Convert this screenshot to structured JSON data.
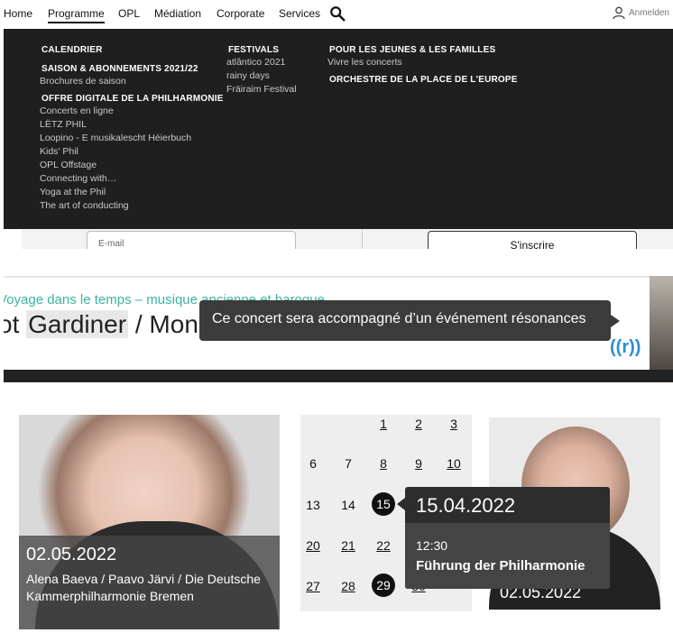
{
  "nav": {
    "items": [
      "Home",
      "Programme",
      "OPL",
      "Médiation",
      "Corporate",
      "Services"
    ],
    "active": "Programme",
    "login_label": "Anmelden"
  },
  "menu": {
    "col1": {
      "calendrier": "CALENDRIER",
      "saison": "SAISON & ABONNEMENTS 2021/22",
      "saison_links": [
        "Brochures de saison"
      ],
      "offre": "OFFRE DIGITALE DE LA PHILHARMONIE",
      "offre_links": [
        "Concerts en ligne",
        "LËTZ PHIL",
        "Loopino - E musikalescht Héierbuch",
        "Kids' Phil",
        "OPL Offstage",
        "Connecting with…",
        "Yoga at the Phil",
        "The art of conducting"
      ]
    },
    "col2": {
      "festivals": "FESTIVALS",
      "festival_links": [
        "atlântico 2021",
        "rainy days",
        "Fräiraim Festival"
      ]
    },
    "col3": {
      "jeunes": "POUR LES JEUNES & LES FAMILLES",
      "jeunes_links": [
        "Vivre les concerts"
      ],
      "orchestre": "ORCHESTRE DE LA PLACE DE L'EUROPE"
    }
  },
  "newsletter": {
    "email_placeholder": "E-mail",
    "subscribe_label": "S'inscrire"
  },
  "banner": {
    "subtitle": "Voyage dans le temps – musique ancienne et baroque",
    "title_part1": "ot ",
    "title_highlight": "Gardiner",
    "title_part2": " / Mon",
    "tooltip": "Ce concert sera accompagné d’un événement résonances",
    "logo": "((r))"
  },
  "card_left": {
    "date": "02.05.2022",
    "title": "Alena Baeva / Paavo Järvi / Die Deutsche Kammerphilharmonie Bremen"
  },
  "calendar": {
    "rows": [
      [
        "",
        "",
        "1",
        "2",
        "3"
      ],
      [
        "6",
        "7",
        "8",
        "9",
        "10"
      ],
      [
        "13",
        "14",
        "15",
        "",
        ""
      ],
      [
        "20",
        "21",
        "22",
        "",
        ""
      ],
      [
        "27",
        "28",
        "29",
        "30",
        ""
      ]
    ]
  },
  "popup": {
    "date": "15.04.2022",
    "time": "12:30",
    "title": "Führung der Philharmonie"
  },
  "card_right": {
    "date": "02.05.2022"
  }
}
